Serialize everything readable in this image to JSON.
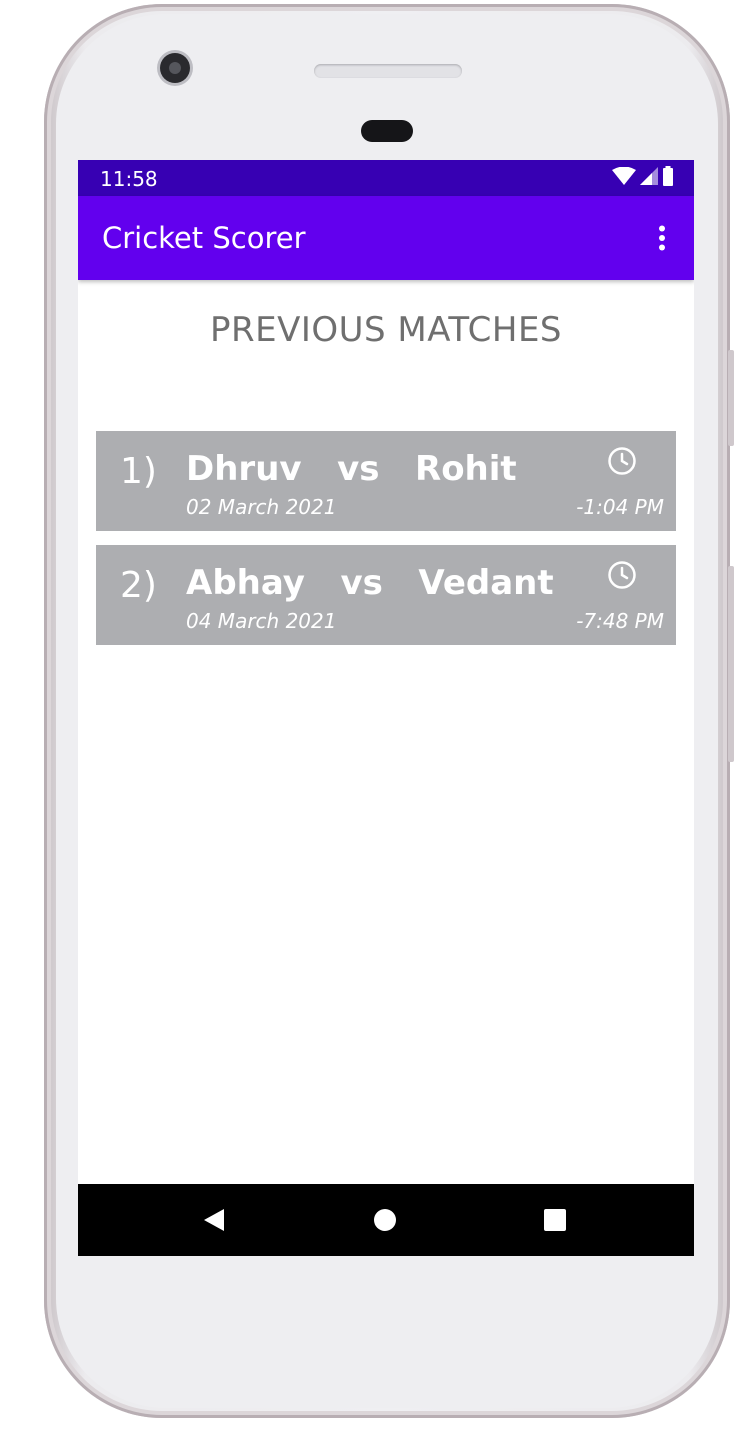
{
  "status_bar": {
    "time": "11:58",
    "icons": [
      "wifi-icon",
      "signal-icon",
      "battery-icon"
    ]
  },
  "app_bar": {
    "title": "Cricket Scorer",
    "menu_icon": "more-vert-icon"
  },
  "main": {
    "heading": "PREVIOUS MATCHES",
    "matches": [
      {
        "index": "1)",
        "team_a": "Dhruv",
        "vs": "vs",
        "team_b": "Rohit",
        "date": "02 March 2021",
        "time": "-1:04 PM",
        "icon": "clock-icon"
      },
      {
        "index": "2)",
        "team_a": "Abhay",
        "vs": "vs",
        "team_b": "Vedant",
        "date": "04 March 2021",
        "time": "-7:48 PM",
        "icon": "clock-icon"
      }
    ]
  },
  "nav_bar": {
    "buttons": [
      "back-icon",
      "home-icon",
      "recents-icon"
    ]
  },
  "colors": {
    "status_bar": "#3700b3",
    "app_bar": "#6200ee",
    "card": "#adaeb1",
    "heading_text": "#6f6f6f"
  }
}
